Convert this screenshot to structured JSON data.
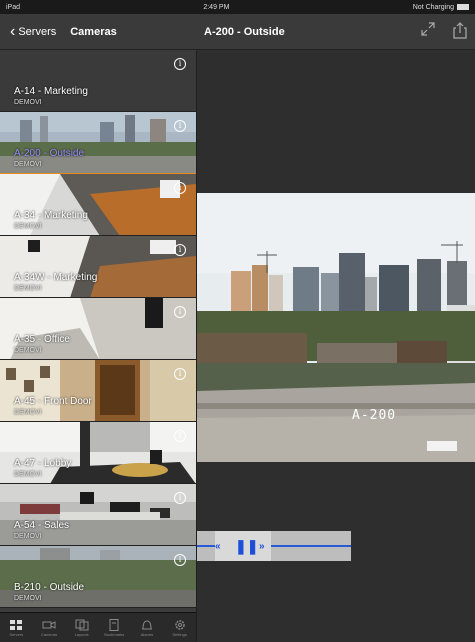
{
  "status": {
    "device": "iPad",
    "time": "2:49 PM",
    "battery": "Not Charging"
  },
  "nav": {
    "back_label": "Servers",
    "left_title": "Cameras",
    "right_title": "A-200 - Outside"
  },
  "cameras": [
    {
      "name": "A-14 - Marketing",
      "server": "DEMOVI"
    },
    {
      "name": "A-200 - Outside",
      "server": "DEMOVI"
    },
    {
      "name": "A-34 - Marketing",
      "server": "DEMOVI"
    },
    {
      "name": "A-34W - Marketing",
      "server": "DEMOVI"
    },
    {
      "name": "A-35 - Office",
      "server": "DEMOVI"
    },
    {
      "name": "A-45 - Front Door",
      "server": "DEMOVI"
    },
    {
      "name": "A-47 - Lobby",
      "server": "DEMOVI"
    },
    {
      "name": "A-54 - Sales",
      "server": "DEMOVI"
    },
    {
      "name": "B-210 - Outside",
      "server": "DEMOVI"
    }
  ],
  "info_glyph": "i",
  "video": {
    "watermark": "A-200"
  },
  "tabs": [
    {
      "label": "Servers",
      "icon": "grid-icon"
    },
    {
      "label": "Cameras",
      "icon": "camera-icon"
    },
    {
      "label": "Layouts",
      "icon": "layouts-icon"
    },
    {
      "label": "Bookmarks",
      "icon": "document-icon"
    },
    {
      "label": "Alarms",
      "icon": "alarm-icon"
    },
    {
      "label": "Settings",
      "icon": "gear-icon"
    }
  ],
  "playback": {
    "rewind": "«",
    "pause": "❚❚",
    "forward": "»"
  },
  "colors": {
    "selected_border": "#e88b1e",
    "selected_text": "#9b88ff",
    "control_accent": "#1d4fd8"
  }
}
